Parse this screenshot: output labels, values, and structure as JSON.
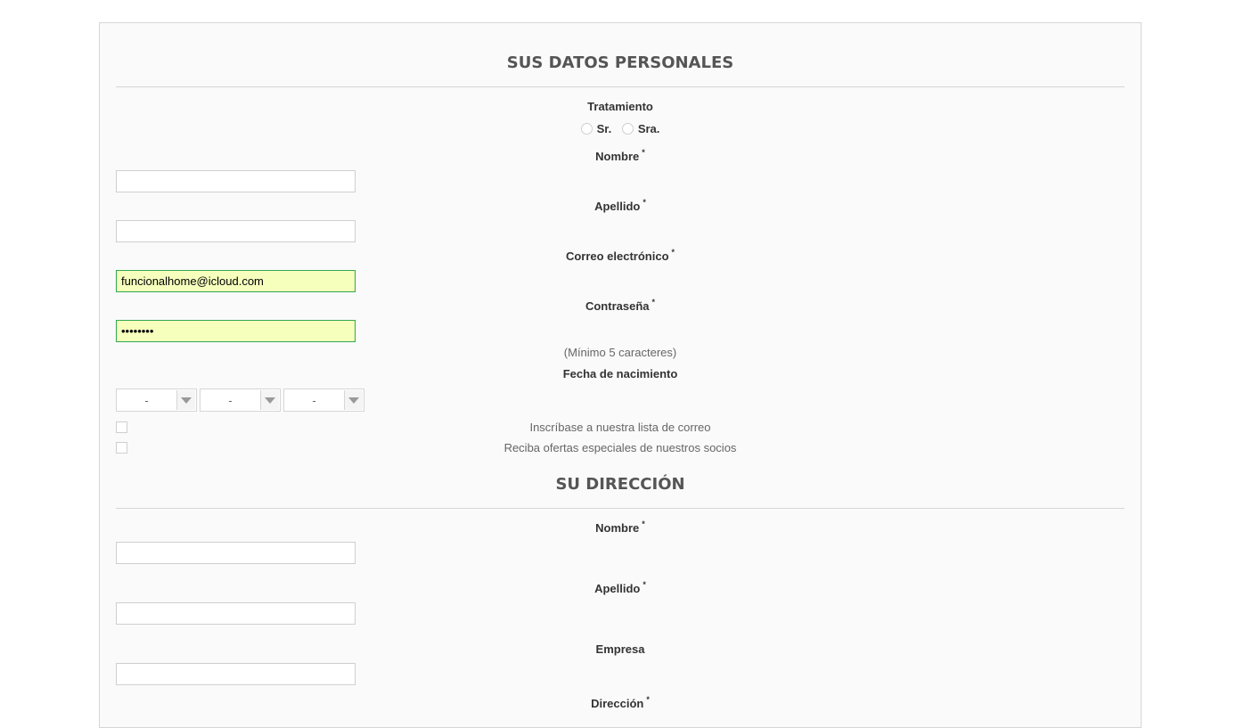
{
  "personal": {
    "heading": "SUS DATOS PERSONALES",
    "title_label": "Tratamiento",
    "title_options": [
      "Sr.",
      "Sra."
    ],
    "first_name_label": "Nombre",
    "first_name_value": "",
    "last_name_label": "Apellido",
    "last_name_value": "",
    "email_label": "Correo electrónico",
    "email_value": "funcionalhome@icloud.com",
    "password_label": "Contraseña",
    "password_value": "••••••••",
    "password_hint": "(Mínimo 5 caracteres)",
    "birthdate_label": "Fecha de nacimiento",
    "birthdate_day": "-",
    "birthdate_month": "-",
    "birthdate_year": "-",
    "newsletter_label": "Inscríbase a nuestra lista de correo",
    "optin_label": "Reciba ofertas especiales de nuestros socios",
    "required_mark": "*"
  },
  "address": {
    "heading": "SU DIRECCIÓN",
    "first_name_label": "Nombre",
    "first_name_value": "",
    "last_name_label": "Apellido",
    "last_name_value": "",
    "company_label": "Empresa",
    "company_value": "",
    "address_label": "Dirección"
  },
  "colors": {
    "autofill_bg": "#f7ffbd",
    "autofill_border": "#32a852",
    "heading_text": "#555555"
  }
}
